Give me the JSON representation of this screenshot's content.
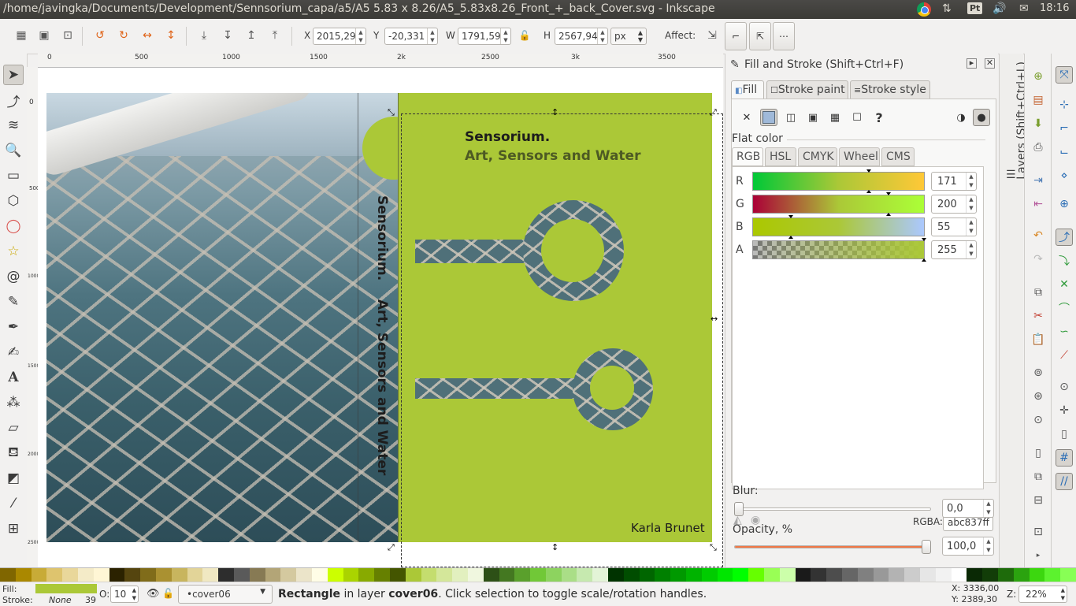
{
  "window": {
    "title": "/home/javingka/Documents/Development/Sennsorium_capa/a5/A5 5.83 x 8.26/A5_5.83x8.26_Front_+_back_Cover.svg - Inkscape",
    "tray": {
      "lang": "Pt",
      "time": "18:16"
    }
  },
  "controls": {
    "x_label": "X",
    "x_value": "2015,29",
    "y_label": "Y",
    "y_value": "-20,331",
    "w_label": "W",
    "w_value": "1791,59",
    "h_label": "H",
    "h_value": "2567,94",
    "unit": "px",
    "affect_label": "Affect:"
  },
  "ruler": {
    "h_ticks": [
      "0",
      "500",
      "1000",
      "1500",
      "2k",
      "2500",
      "3k",
      "3500"
    ],
    "v_ticks": [
      "0",
      "500",
      "1000",
      "1500",
      "2000",
      "2500"
    ]
  },
  "cover": {
    "spine_line1": "Sensorium.",
    "spine_line2": "Art, Sensors and Water",
    "title": "Sensorium.",
    "subtitle": "Art, Sensors and Water",
    "author": "Karla Brunet",
    "colors": {
      "green": "#abc837",
      "water": "#4f7079"
    }
  },
  "dialog": {
    "title": "Fill and Stroke (Shift+Ctrl+F)",
    "tabs": [
      "Fill",
      "Stroke paint",
      "Stroke style"
    ],
    "flat_color_label": "Flat color",
    "color_modes": [
      "RGB",
      "HSL",
      "CMYK",
      "Wheel",
      "CMS"
    ],
    "channels": [
      {
        "label": "R",
        "value": "171"
      },
      {
        "label": "G",
        "value": "200"
      },
      {
        "label": "B",
        "value": "55"
      },
      {
        "label": "A",
        "value": "255"
      }
    ],
    "rgba_label": "RGBA:",
    "rgba_value": "abc837ff",
    "blur_label": "Blur:",
    "blur_value": "0,0",
    "opacity_label": "Opacity, %",
    "opacity_value": "100,0",
    "opacity_fraction": 1.0
  },
  "layers_tab": {
    "label": "Layers (Shift+Ctrl+L)"
  },
  "palette": {
    "swatches": [
      "#806600",
      "#aa8800",
      "#c8ab37",
      "#dec46e",
      "#e9d79a",
      "#f4ebc8",
      "#fff6d5",
      "#2b2200",
      "#55450f",
      "#806c1a",
      "#aa9131",
      "#c8b55e",
      "#e2d498",
      "#f0e8c2",
      "#2d2d2d",
      "#5a5a5a",
      "#877a54",
      "#b3a577",
      "#d4c99f",
      "#ebe4c9",
      "#fffde6",
      "#ccff00",
      "#aad400",
      "#88aa00",
      "#668000",
      "#445500",
      "#abc837",
      "#c4dd6e",
      "#d4e79a",
      "#e2f0bf",
      "#f0f7df",
      "#2d5016",
      "#447821",
      "#5aa02c",
      "#71c837",
      "#8dd35f",
      "#aade87",
      "#c6e9af",
      "#e3f4d7",
      "#003300",
      "#004d00",
      "#006600",
      "#008000",
      "#009900",
      "#00b300",
      "#00cc00",
      "#00e600",
      "#00ff00",
      "#66ff00",
      "#99ff55",
      "#ccffaa",
      "#1a1a1a",
      "#333333",
      "#4d4d4d",
      "#666666",
      "#808080",
      "#999999",
      "#b3b3b3",
      "#cccccc",
      "#e6e6e6",
      "#f2f2f2",
      "#ffffff",
      "#0a2905",
      "#123d08",
      "#1e6b0b",
      "#2ba30f",
      "#3cd70f",
      "#5cf22e",
      "#88ff55"
    ]
  },
  "status": {
    "fill_label": "Fill:",
    "stroke_label": "Stroke:",
    "stroke_value": "None",
    "stroke_width": "39",
    "opacity_label": "O:",
    "opacity_value": "10",
    "layer": "•cover06",
    "message_bold1": "Rectangle",
    "message_mid": " in layer ",
    "message_bold2": "cover06",
    "message_end": ". Click selection to toggle scale/rotation handles.",
    "x_coord": "X: 3336,00",
    "y_coord": "Y: 2389,30",
    "zoom_label": "Z:",
    "zoom_value": "22%"
  }
}
